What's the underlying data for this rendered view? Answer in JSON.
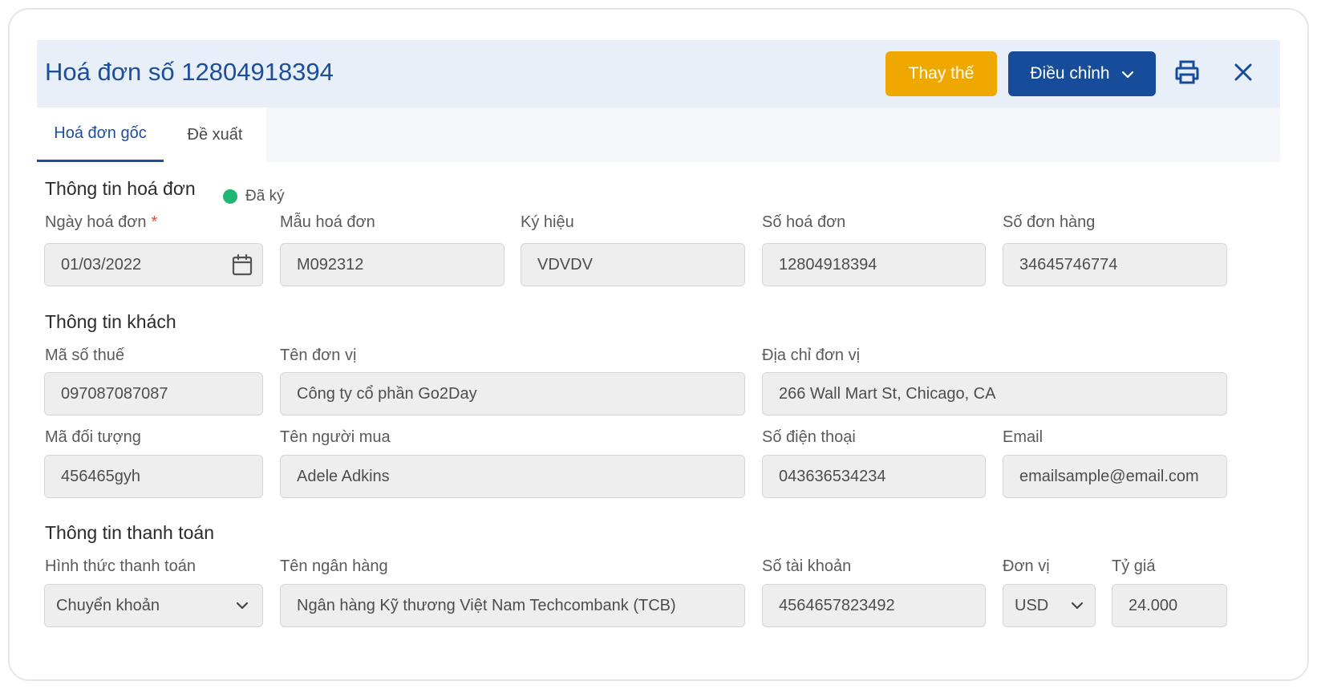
{
  "header": {
    "title": "Hoá đơn số 12804918394",
    "replace_label": "Thay thế",
    "adjust_label": "Điều chỉnh"
  },
  "tabs": [
    {
      "label": "Hoá đơn gốc",
      "active": true
    },
    {
      "label": "Đề xuất",
      "active": false
    }
  ],
  "invoice_info": {
    "section_title": "Thông tin hoá đơn",
    "status": "Đã ký",
    "status_color": "#22b573",
    "date": {
      "label": "Ngày hoá đơn",
      "required_mark": "*",
      "value": "01/03/2022"
    },
    "template": {
      "label": "Mẫu hoá đơn",
      "value": "M092312"
    },
    "symbol": {
      "label": "Ký hiệu",
      "value": "VDVDV"
    },
    "invoice_no": {
      "label": "Số hoá đơn",
      "value": "12804918394"
    },
    "order_no": {
      "label": "Số đơn hàng",
      "value": "34645746774"
    }
  },
  "customer_info": {
    "section_title": "Thông tin khách",
    "tax_code": {
      "label": "Mã số thuế",
      "value": "097087087087"
    },
    "company": {
      "label": "Tên đơn vị",
      "value": "Công ty cổ phần Go2Day"
    },
    "address": {
      "label": "Địa chỉ đơn vị",
      "value": "266 Wall Mart St, Chicago, CA"
    },
    "object_code": {
      "label": "Mã đối tượng",
      "value": "456465gyh"
    },
    "buyer": {
      "label": "Tên người mua",
      "value": "Adele Adkins"
    },
    "phone": {
      "label": "Số điện thoại",
      "value": "043636534234"
    },
    "email": {
      "label": "Email",
      "value": "emailsample@email.com"
    }
  },
  "payment_info": {
    "section_title": "Thông tin thanh toán",
    "method": {
      "label": "Hình thức thanh toán",
      "value": "Chuyển khoản"
    },
    "bank": {
      "label": "Tên ngân hàng",
      "value": "Ngân hàng Kỹ thương Việt Nam Techcombank (TCB)"
    },
    "account": {
      "label": "Số tài khoản",
      "value": "4564657823492"
    },
    "currency": {
      "label": "Đơn vị",
      "value": "USD"
    },
    "rate": {
      "label": "Tỷ giá",
      "value": "24.000"
    }
  },
  "colors": {
    "primary": "#164c9a",
    "accent": "#efa800",
    "header_bg": "#e8eff8"
  }
}
